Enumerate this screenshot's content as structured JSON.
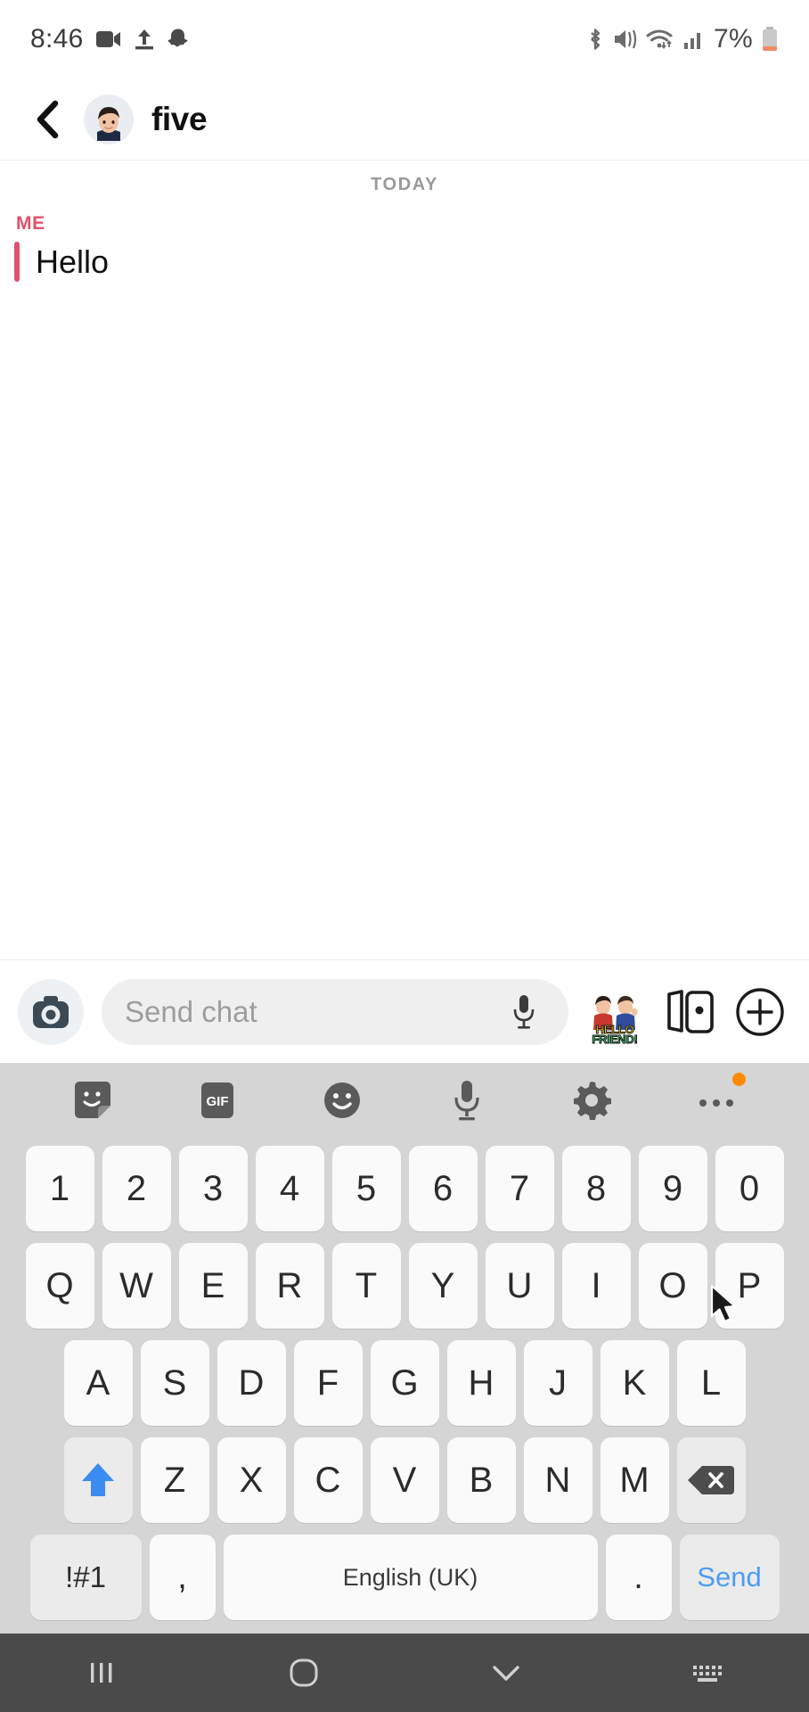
{
  "status_bar": {
    "time": "8:46",
    "battery_percent": "7%",
    "left_icons": [
      "video-camera-icon",
      "upload-icon",
      "snapchat-ghost-icon"
    ],
    "right_icons": [
      "bluetooth-icon",
      "vibrate-icon",
      "wifi-icon",
      "cellular-signal-icon"
    ],
    "battery_icon": "battery-low-icon"
  },
  "header": {
    "back_icon": "back-chevron-icon",
    "avatar": "bitmoji-avatar",
    "title": "five"
  },
  "chat": {
    "day_divider": "TODAY",
    "messages": [
      {
        "sender": "ME",
        "text": "Hello",
        "accent_color": "#E0526B"
      }
    ]
  },
  "input_bar": {
    "camera_icon": "camera-icon",
    "placeholder": "Send chat",
    "mic_icon": "microphone-icon",
    "sticker": {
      "icon": "bitmoji-hello-friend-sticker",
      "line1": "HELLO",
      "line2": "FRIEND!"
    },
    "cards_icon": "sticker-cards-icon",
    "plus_icon": "plus-circle-icon"
  },
  "keyboard": {
    "toolbar": [
      {
        "name": "sticker-icon",
        "label": ""
      },
      {
        "name": "gif-icon",
        "label": "GIF"
      },
      {
        "name": "emoji-icon",
        "label": ""
      },
      {
        "name": "microphone-icon",
        "label": ""
      },
      {
        "name": "settings-gear-icon",
        "label": ""
      },
      {
        "name": "more-options-icon",
        "label": "",
        "badge": true
      }
    ],
    "row_numbers": [
      "1",
      "2",
      "3",
      "4",
      "5",
      "6",
      "7",
      "8",
      "9",
      "0"
    ],
    "row_top": [
      "Q",
      "W",
      "E",
      "R",
      "T",
      "Y",
      "U",
      "I",
      "O",
      "P"
    ],
    "row_home": [
      "A",
      "S",
      "D",
      "F",
      "G",
      "H",
      "J",
      "K",
      "L"
    ],
    "row_bottom": [
      "Z",
      "X",
      "C",
      "V",
      "B",
      "N",
      "M"
    ],
    "shift_icon": "shift-arrow-icon",
    "backspace_icon": "backspace-icon",
    "symbols_key": "!#1",
    "comma_key": ",",
    "space_key": "English (UK)",
    "period_key": ".",
    "send_key": "Send",
    "accent_color": "#4c9cf5"
  },
  "nav_bar": {
    "recents_icon": "recent-apps-icon",
    "home_icon": "home-icon",
    "hide_keyboard_icon": "chevron-down-icon",
    "keyboard_icon": "keyboard-icon"
  }
}
